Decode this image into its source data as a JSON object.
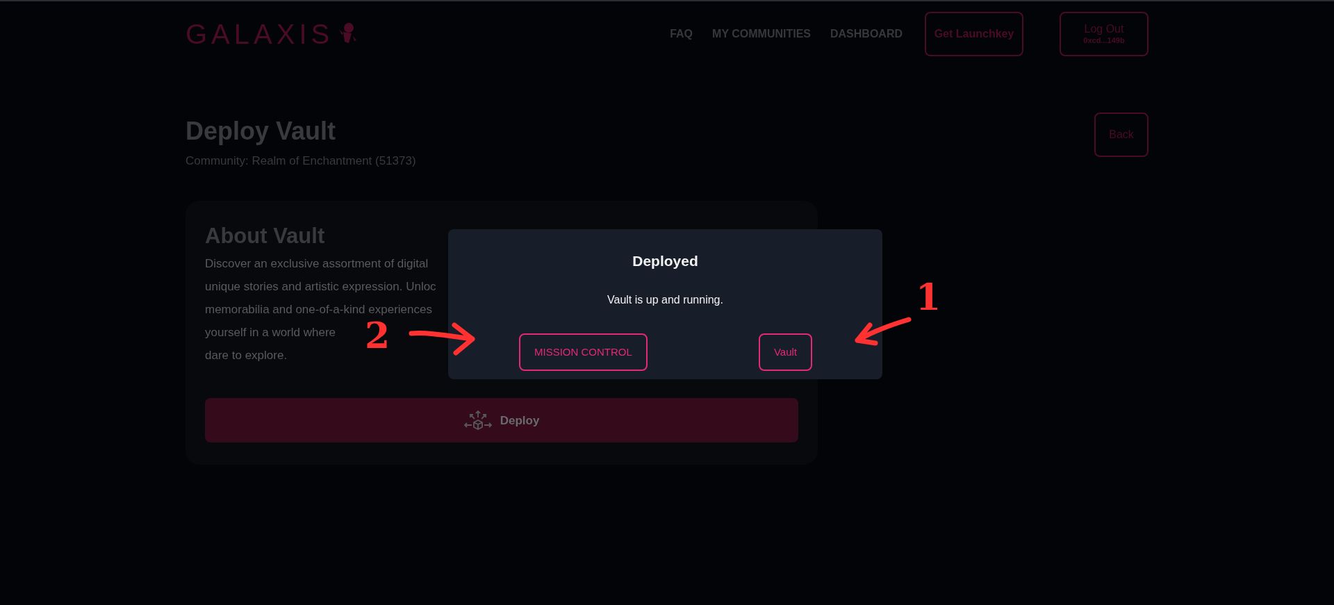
{
  "header": {
    "logo": "GALAXIS",
    "nav": [
      "FAQ",
      "MY COMMUNITIES",
      "DASHBOARD"
    ],
    "launch_button": "Get Launchkey",
    "logout": {
      "label": "Log Out",
      "address": "0xcd...149b"
    }
  },
  "page": {
    "title": "Deploy Vault",
    "subtitle": "Community: Realm of Enchantment (51373)",
    "back_button": "Back"
  },
  "card": {
    "heading": "About Vault",
    "description_lines": [
      "Discover an exclusive assortment of digital",
      "unique stories and artistic expression. Unloc",
      "memorabilia and one-of-a-kind experiences",
      "yourself in a world where",
      "dare to explore."
    ],
    "deploy_button": "Deploy"
  },
  "dialog": {
    "title": "Deployed",
    "message": "Vault is up and running.",
    "buttons": [
      "MISSION CONTROL",
      "Vault"
    ]
  },
  "annotations": [
    {
      "label": "1"
    },
    {
      "label": "2"
    }
  ]
}
